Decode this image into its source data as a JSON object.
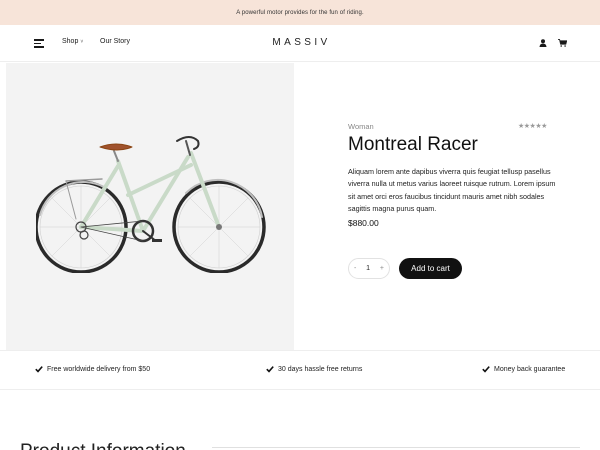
{
  "announcement": {
    "text": "A powerful motor provides for the fun of riding."
  },
  "header": {
    "nav": {
      "shop": "Shop",
      "shop_chevron": "˅",
      "story": "Our Story"
    },
    "logo": "MASSIV"
  },
  "product": {
    "category": "Woman",
    "rating": {
      "stars": "★★★★★",
      "value": 0,
      "max": 5
    },
    "title": "Montreal Racer",
    "description": "Aliquam lorem ante dapibus viverra quis feugiat tellusp pasellus viverra nulla ut metus varius laoreet ruisque rutrum. Lorem ipsum sit amet orci eros faucibus tincidunt mauris amet nibh sodales sagittis magna purus quam.",
    "price": "$880.00",
    "quantity": {
      "minus": "-",
      "value": "1",
      "plus": "+"
    },
    "add_to_cart": "Add to cart",
    "image": {
      "frame_color": "#c9dac8",
      "saddle_color": "#a0522d"
    }
  },
  "features": [
    {
      "text": "Free worldwide delivery from $50"
    },
    {
      "text": "30 days hassle free returns"
    },
    {
      "text": "Money back guarantee"
    }
  ],
  "section": {
    "heading": "Product Information"
  },
  "colors": {
    "announcement_bg": "#f7e4d9",
    "gallery_bg": "#f3f3f3",
    "button_bg": "#111111"
  }
}
